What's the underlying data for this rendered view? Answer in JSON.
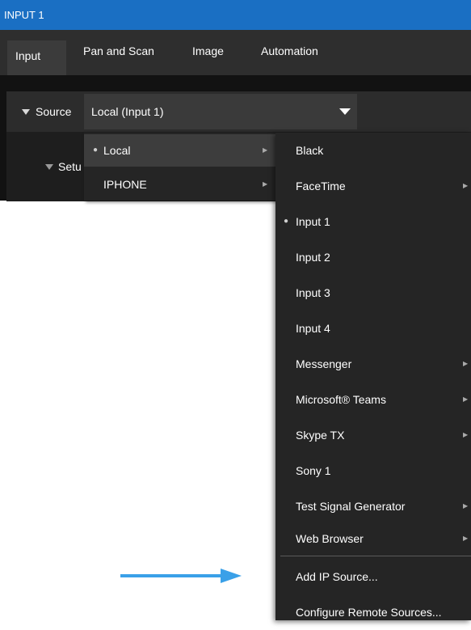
{
  "window": {
    "title": "INPUT 1",
    "accent": "#1a6fc3"
  },
  "tabs": [
    {
      "label": "Input",
      "active": true
    },
    {
      "label": "Pan and Scan",
      "active": false
    },
    {
      "label": "Image",
      "active": false
    },
    {
      "label": "Automation",
      "active": false
    }
  ],
  "source": {
    "label": "Source",
    "selected": "Local (Input 1)"
  },
  "setup": {
    "label": "Setu"
  },
  "menu_categories": [
    {
      "label": "Local",
      "checked": true,
      "has_submenu": true
    },
    {
      "label": "IPHONE",
      "checked": false,
      "has_submenu": true
    }
  ],
  "menu_sources": [
    {
      "label": "Black",
      "checked": false,
      "has_submenu": false
    },
    {
      "label": "FaceTime",
      "checked": false,
      "has_submenu": true
    },
    {
      "label": "Input 1",
      "checked": true,
      "has_submenu": false
    },
    {
      "label": "Input 2",
      "checked": false,
      "has_submenu": false
    },
    {
      "label": "Input 3",
      "checked": false,
      "has_submenu": false
    },
    {
      "label": "Input 4",
      "checked": false,
      "has_submenu": false
    },
    {
      "label": "Messenger",
      "checked": false,
      "has_submenu": true
    },
    {
      "label": "Microsoft® Teams",
      "checked": false,
      "has_submenu": true
    },
    {
      "label": "Skype TX",
      "checked": false,
      "has_submenu": true
    },
    {
      "label": "Sony 1",
      "checked": false,
      "has_submenu": false
    },
    {
      "label": "Test Signal Generator",
      "checked": false,
      "has_submenu": true
    },
    {
      "label": "Web Browser",
      "checked": false,
      "has_submenu": true
    }
  ],
  "menu_actions": [
    {
      "label": "Add IP Source..."
    },
    {
      "label": "Configure Remote Sources..."
    }
  ],
  "annotation": {
    "arrow_color": "#3aa0e8"
  }
}
